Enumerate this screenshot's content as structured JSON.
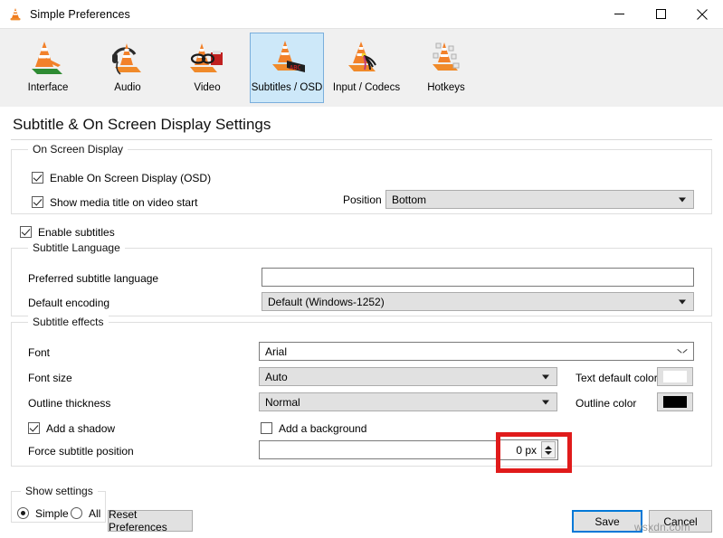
{
  "window": {
    "title": "Simple Preferences",
    "icon": "vlc-cone-icon",
    "controls": {
      "minimize": "—",
      "maximize": "☐",
      "close": "✕"
    }
  },
  "toolbar": {
    "items": [
      {
        "label": "Interface",
        "icon": "vlc-cone-interface-icon",
        "selected": false
      },
      {
        "label": "Audio",
        "icon": "vlc-cone-headphones-icon",
        "selected": false
      },
      {
        "label": "Video",
        "icon": "vlc-cone-3dglasses-icon",
        "selected": false
      },
      {
        "label": "Subtitles / OSD",
        "icon": "vlc-cone-osd-icon",
        "selected": true
      },
      {
        "label": "Input / Codecs",
        "icon": "vlc-cone-cables-icon",
        "selected": false
      },
      {
        "label": "Hotkeys",
        "icon": "vlc-cone-keyboard-icon",
        "selected": false
      }
    ]
  },
  "page": {
    "title": "Subtitle & On Screen Display Settings"
  },
  "osd": {
    "group_title": "On Screen Display",
    "enable_osd": {
      "label": "Enable On Screen Display (OSD)",
      "checked": true
    },
    "show_media_title": {
      "label": "Show media title on video start",
      "checked": true
    },
    "position": {
      "label": "Position",
      "value": "Bottom"
    }
  },
  "enable_subtitles": {
    "label": "Enable subtitles",
    "checked": true
  },
  "subtitle_language": {
    "group_title": "Subtitle Language",
    "preferred_language": {
      "label": "Preferred subtitle language",
      "value": ""
    },
    "default_encoding": {
      "label": "Default encoding",
      "value": "Default (Windows-1252)"
    }
  },
  "subtitle_effects": {
    "group_title": "Subtitle effects",
    "font": {
      "label": "Font",
      "value": "Arial"
    },
    "font_size": {
      "label": "Font size",
      "value": "Auto"
    },
    "outline_thickness": {
      "label": "Outline thickness",
      "value": "Normal"
    },
    "text_default_color": {
      "label": "Text default color",
      "color": "#ffffff"
    },
    "outline_color": {
      "label": "Outline color",
      "color": "#000000"
    },
    "add_shadow": {
      "label": "Add a shadow",
      "checked": true
    },
    "add_background": {
      "label": "Add a background",
      "checked": false
    },
    "force_subtitle_position": {
      "label": "Force subtitle position",
      "value": "0 px"
    }
  },
  "highlight": {
    "color": "#e01b1b",
    "target": "force-subtitle-position-spinbox"
  },
  "footer": {
    "show_settings": {
      "group_title": "Show settings",
      "simple": {
        "label": "Simple",
        "selected": true
      },
      "all": {
        "label": "All",
        "selected": false
      }
    },
    "reset_button": "Reset Preferences",
    "save_button": "Save",
    "cancel_button": "Cancel",
    "watermark": "wsxdn.com"
  }
}
